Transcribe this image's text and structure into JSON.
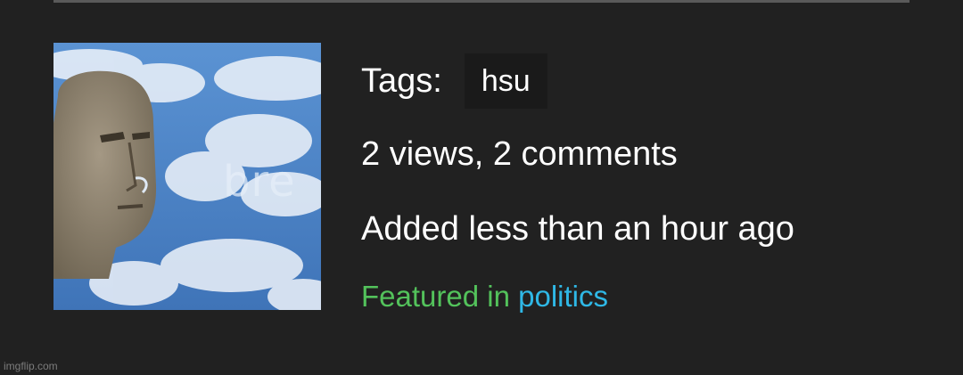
{
  "tags": {
    "label": "Tags:",
    "items": [
      "hsu"
    ]
  },
  "stats": {
    "text": "2 views, 2 comments"
  },
  "added": {
    "text": "Added less than an hour ago"
  },
  "featured": {
    "prefix": "Featured in ",
    "stream": "politics"
  },
  "thumbnail": {
    "caption": "bre"
  },
  "watermark": "imgflip.com",
  "colors": {
    "background": "#212121",
    "chip": "#1a1a1a",
    "featured_green": "#53c25b",
    "stream_blue": "#2fb8e6"
  }
}
